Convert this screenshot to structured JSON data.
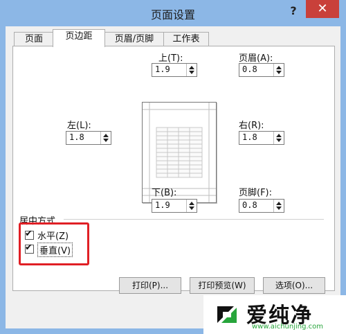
{
  "window": {
    "title": "页面设置",
    "help_glyph": "?",
    "close_glyph": "✕"
  },
  "tabs": [
    {
      "label": "页面"
    },
    {
      "label": "页边距"
    },
    {
      "label": "页眉/页脚"
    },
    {
      "label": "工作表"
    }
  ],
  "margins": {
    "top": {
      "label": "上(T):",
      "value": "1.9"
    },
    "header": {
      "label": "页眉(A):",
      "value": "0.8"
    },
    "left": {
      "label": "左(L):",
      "value": "1.8"
    },
    "right": {
      "label": "右(R):",
      "value": "1.8"
    },
    "bottom": {
      "label": "下(B):",
      "value": "1.9"
    },
    "footer": {
      "label": "页脚(F):",
      "value": "0.8"
    }
  },
  "centering": {
    "title": "居中方式",
    "horizontal": {
      "label": "水平(Z)",
      "checked": true
    },
    "vertical": {
      "label": "垂直(V)",
      "checked": true
    }
  },
  "buttons": {
    "print": "打印(P)...",
    "print_preview": "打印预览(W)",
    "options": "选项(O)..."
  },
  "watermark": {
    "brand": "爱纯净",
    "url": "www.aichunjing.com"
  },
  "colors": {
    "highlight": "#e01f25",
    "close_button": "#c9403a",
    "frame": "#8cb7e6"
  }
}
